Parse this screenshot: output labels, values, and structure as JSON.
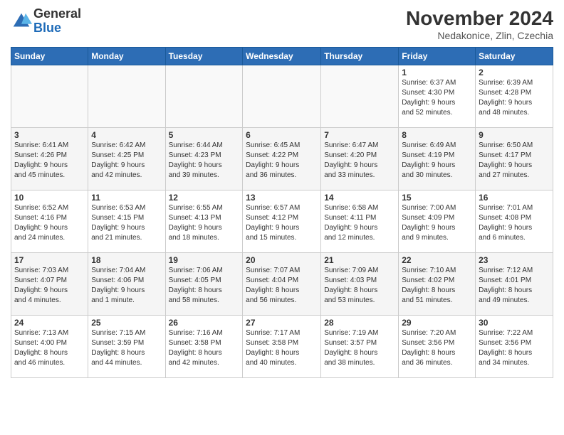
{
  "header": {
    "logo_general": "General",
    "logo_blue": "Blue",
    "title": "November 2024",
    "subtitle": "Nedakonice, Zlin, Czechia"
  },
  "calendar": {
    "days_of_week": [
      "Sunday",
      "Monday",
      "Tuesday",
      "Wednesday",
      "Thursday",
      "Friday",
      "Saturday"
    ],
    "weeks": [
      [
        {
          "day": "",
          "info": ""
        },
        {
          "day": "",
          "info": ""
        },
        {
          "day": "",
          "info": ""
        },
        {
          "day": "",
          "info": ""
        },
        {
          "day": "",
          "info": ""
        },
        {
          "day": "1",
          "info": "Sunrise: 6:37 AM\nSunset: 4:30 PM\nDaylight: 9 hours\nand 52 minutes."
        },
        {
          "day": "2",
          "info": "Sunrise: 6:39 AM\nSunset: 4:28 PM\nDaylight: 9 hours\nand 48 minutes."
        }
      ],
      [
        {
          "day": "3",
          "info": "Sunrise: 6:41 AM\nSunset: 4:26 PM\nDaylight: 9 hours\nand 45 minutes."
        },
        {
          "day": "4",
          "info": "Sunrise: 6:42 AM\nSunset: 4:25 PM\nDaylight: 9 hours\nand 42 minutes."
        },
        {
          "day": "5",
          "info": "Sunrise: 6:44 AM\nSunset: 4:23 PM\nDaylight: 9 hours\nand 39 minutes."
        },
        {
          "day": "6",
          "info": "Sunrise: 6:45 AM\nSunset: 4:22 PM\nDaylight: 9 hours\nand 36 minutes."
        },
        {
          "day": "7",
          "info": "Sunrise: 6:47 AM\nSunset: 4:20 PM\nDaylight: 9 hours\nand 33 minutes."
        },
        {
          "day": "8",
          "info": "Sunrise: 6:49 AM\nSunset: 4:19 PM\nDaylight: 9 hours\nand 30 minutes."
        },
        {
          "day": "9",
          "info": "Sunrise: 6:50 AM\nSunset: 4:17 PM\nDaylight: 9 hours\nand 27 minutes."
        }
      ],
      [
        {
          "day": "10",
          "info": "Sunrise: 6:52 AM\nSunset: 4:16 PM\nDaylight: 9 hours\nand 24 minutes."
        },
        {
          "day": "11",
          "info": "Sunrise: 6:53 AM\nSunset: 4:15 PM\nDaylight: 9 hours\nand 21 minutes."
        },
        {
          "day": "12",
          "info": "Sunrise: 6:55 AM\nSunset: 4:13 PM\nDaylight: 9 hours\nand 18 minutes."
        },
        {
          "day": "13",
          "info": "Sunrise: 6:57 AM\nSunset: 4:12 PM\nDaylight: 9 hours\nand 15 minutes."
        },
        {
          "day": "14",
          "info": "Sunrise: 6:58 AM\nSunset: 4:11 PM\nDaylight: 9 hours\nand 12 minutes."
        },
        {
          "day": "15",
          "info": "Sunrise: 7:00 AM\nSunset: 4:09 PM\nDaylight: 9 hours\nand 9 minutes."
        },
        {
          "day": "16",
          "info": "Sunrise: 7:01 AM\nSunset: 4:08 PM\nDaylight: 9 hours\nand 6 minutes."
        }
      ],
      [
        {
          "day": "17",
          "info": "Sunrise: 7:03 AM\nSunset: 4:07 PM\nDaylight: 9 hours\nand 4 minutes."
        },
        {
          "day": "18",
          "info": "Sunrise: 7:04 AM\nSunset: 4:06 PM\nDaylight: 9 hours\nand 1 minute."
        },
        {
          "day": "19",
          "info": "Sunrise: 7:06 AM\nSunset: 4:05 PM\nDaylight: 8 hours\nand 58 minutes."
        },
        {
          "day": "20",
          "info": "Sunrise: 7:07 AM\nSunset: 4:04 PM\nDaylight: 8 hours\nand 56 minutes."
        },
        {
          "day": "21",
          "info": "Sunrise: 7:09 AM\nSunset: 4:03 PM\nDaylight: 8 hours\nand 53 minutes."
        },
        {
          "day": "22",
          "info": "Sunrise: 7:10 AM\nSunset: 4:02 PM\nDaylight: 8 hours\nand 51 minutes."
        },
        {
          "day": "23",
          "info": "Sunrise: 7:12 AM\nSunset: 4:01 PM\nDaylight: 8 hours\nand 49 minutes."
        }
      ],
      [
        {
          "day": "24",
          "info": "Sunrise: 7:13 AM\nSunset: 4:00 PM\nDaylight: 8 hours\nand 46 minutes."
        },
        {
          "day": "25",
          "info": "Sunrise: 7:15 AM\nSunset: 3:59 PM\nDaylight: 8 hours\nand 44 minutes."
        },
        {
          "day": "26",
          "info": "Sunrise: 7:16 AM\nSunset: 3:58 PM\nDaylight: 8 hours\nand 42 minutes."
        },
        {
          "day": "27",
          "info": "Sunrise: 7:17 AM\nSunset: 3:58 PM\nDaylight: 8 hours\nand 40 minutes."
        },
        {
          "day": "28",
          "info": "Sunrise: 7:19 AM\nSunset: 3:57 PM\nDaylight: 8 hours\nand 38 minutes."
        },
        {
          "day": "29",
          "info": "Sunrise: 7:20 AM\nSunset: 3:56 PM\nDaylight: 8 hours\nand 36 minutes."
        },
        {
          "day": "30",
          "info": "Sunrise: 7:22 AM\nSunset: 3:56 PM\nDaylight: 8 hours\nand 34 minutes."
        }
      ]
    ]
  }
}
